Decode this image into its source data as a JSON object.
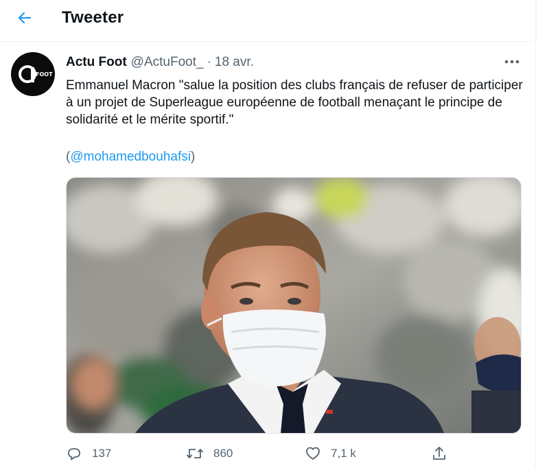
{
  "header": {
    "title": "Tweeter"
  },
  "tweet": {
    "author_name": "Actu Foot",
    "author_handle": "@ActuFoot_",
    "separator": "·",
    "time": "18 avr.",
    "avatar_text": "FOOT",
    "text": "Emmanuel Macron \"salue la position des clubs français de refuser de participer à un projet de Superleague européenne de football menaçant le principe de solidarité et le mérite sportif.\"",
    "mention_open": "(",
    "mention": "@mohamedbouhafsi",
    "mention_close": ")"
  },
  "actions": {
    "replies": "137",
    "retweets": "860",
    "likes": "7,1 k"
  },
  "colors": {
    "accent": "#1d9bf0",
    "text": "#0f1419",
    "secondary": "#536471"
  },
  "icons": [
    "back-arrow-icon",
    "more-icon",
    "reply-icon",
    "retweet-icon",
    "like-icon",
    "share-icon"
  ]
}
